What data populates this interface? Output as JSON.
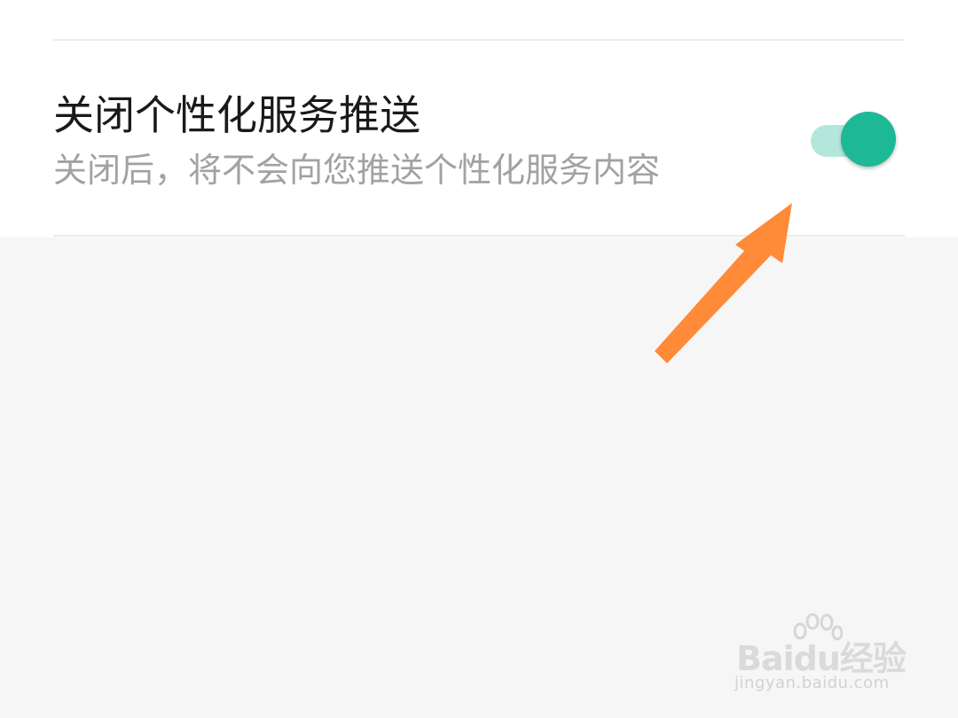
{
  "setting": {
    "title": "关闭个性化服务推送",
    "description": "关闭后，将不会向您推送个性化服务内容",
    "toggle_state": "on"
  },
  "annotation": {
    "arrow_color": "#ff8a37"
  },
  "colors": {
    "accent": "#1db896",
    "track": "#b4e7dc"
  },
  "watermark": {
    "logo": "Baidu经验",
    "url": "jingyan.baidu.com"
  }
}
